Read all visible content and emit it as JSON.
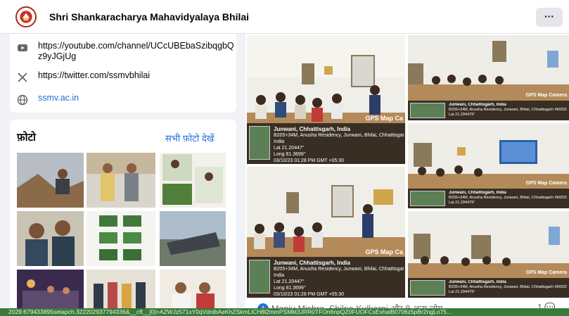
{
  "header": {
    "page_name": "Shri Shankaracharya Mahavidyalaya Bhilai",
    "more_label": "···",
    "logo_icon": "college-seal-logo"
  },
  "intro": {
    "links": [
      {
        "icon": "youtube-icon",
        "text": "https://youtube.com/channel/UCcUBEbaSzibqgbQz9yJGjUg"
      },
      {
        "icon": "x-twitter-icon",
        "text": "https://twitter.com/ssmvbhilai"
      },
      {
        "icon": "globe-icon",
        "text": "ssmv.ac.in"
      }
    ]
  },
  "photos": {
    "title": "फ़ोटो",
    "see_all": "सभी फ़ोटो देखें"
  },
  "post": {
    "gps_badge": "GPS Map Camera",
    "gps_badge_cropped": "GPS Map Ca",
    "location_title": "Junwani, Chhattisgarh, India",
    "gps_line2": "B205+34M, Anusha Residency, Junwani, Bhilai, Chhattisgarh 4",
    "gps_line3": "India",
    "gps_lat": "Lat 21.20447°",
    "gps_long": "Long 81.3699°",
    "gps_date": "03/10/23 01:28 PM GMT +05:30",
    "small_line2": "B205+34M, Anusha Residency, Junwani, Bhilai, Chhattisgarh 490020, India",
    "small_line3": "Lat 21.204479°",
    "reactions_text": "Manju Mishra, Shilpa Kulkarni और 8 अन्य लोग",
    "comment_count": "1 💬"
  },
  "status_url": "2029:679433895setapch.322202937794336&__cft__[0]=AZWJz571xY0qVdnlbAeKhZSkmLlCH8l2mmPSMkt3JRR0TFOn6npQZ0FUOFCsExhaiB0706z5pBr2ngLo75..."
}
